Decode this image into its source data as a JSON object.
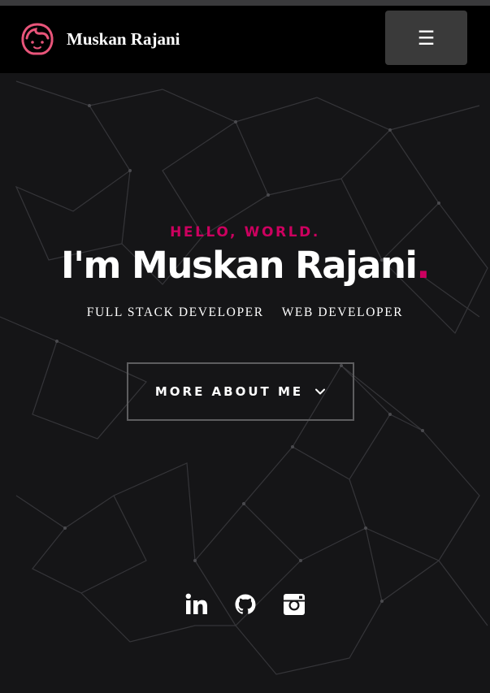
{
  "header": {
    "brand_name": "Muskan Rajani",
    "menu_icon": "☰"
  },
  "hero": {
    "greeting": "HELLO, WORLD.",
    "headline_prefix": "I'm Muskan Rajani",
    "headline_dot": ".",
    "roles": [
      "FULL STACK DEVELOPER",
      "WEB DEVELOPER"
    ],
    "cta_label": "MORE ABOUT ME"
  },
  "social": [
    "linkedin-icon",
    "github-icon",
    "instagram-icon"
  ],
  "colors": {
    "accent": "#cc005f",
    "background": "#151517",
    "navbar": "#000000",
    "menu_button": "#3a3a3a",
    "logo_pink": "#e8557a"
  }
}
